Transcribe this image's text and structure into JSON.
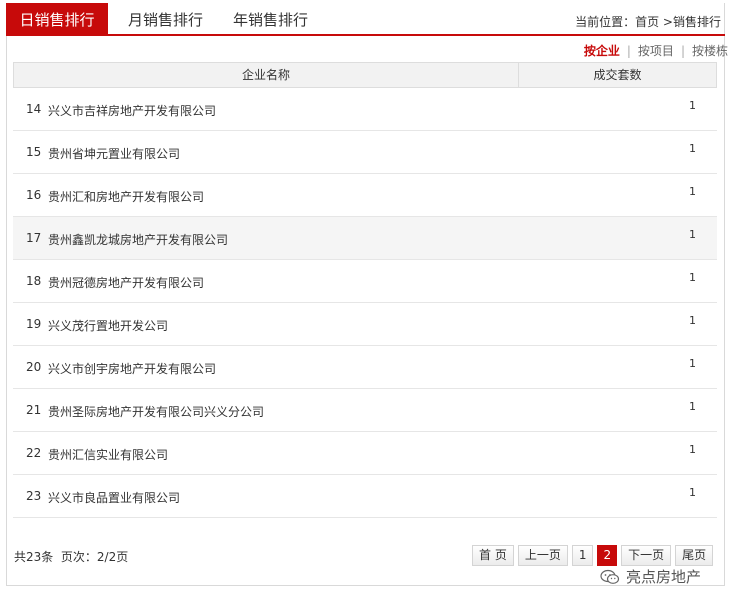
{
  "tabs": [
    {
      "label": "日销售排行",
      "active": true
    },
    {
      "label": "月销售排行",
      "active": false
    },
    {
      "label": "年销售排行",
      "active": false
    }
  ],
  "breadcrumb": {
    "prefix": "当前位置：",
    "home": "首页",
    "sep": " >",
    "current": "销售排行"
  },
  "filters": [
    {
      "label": "按企业",
      "active": true
    },
    {
      "label": "按项目",
      "active": false
    },
    {
      "label": "按楼栋",
      "active": false
    }
  ],
  "filter_sep": "|",
  "table": {
    "headers": {
      "name": "企业名称",
      "count": "成交套数"
    },
    "rows": [
      {
        "rank": "14",
        "name": "兴义市吉祥房地产开发有限公司",
        "count": "1"
      },
      {
        "rank": "15",
        "name": "贵州省坤元置业有限公司",
        "count": "1"
      },
      {
        "rank": "16",
        "name": "贵州汇和房地产开发有限公司",
        "count": "1"
      },
      {
        "rank": "17",
        "name": "贵州鑫凯龙城房地产开发有限公司",
        "count": "1"
      },
      {
        "rank": "18",
        "name": "贵州冠德房地产开发有限公司",
        "count": "1"
      },
      {
        "rank": "19",
        "name": "兴义茂行置地开发公司",
        "count": "1"
      },
      {
        "rank": "20",
        "name": "兴义市创宇房地产开发有限公司",
        "count": "1"
      },
      {
        "rank": "21",
        "name": "贵州圣际房地产开发有限公司兴义分公司",
        "count": "1"
      },
      {
        "rank": "22",
        "name": "贵州汇信实业有限公司",
        "count": "1"
      },
      {
        "rank": "23",
        "name": "兴义市良品置业有限公司",
        "count": "1"
      }
    ]
  },
  "footer": {
    "total": "共23条",
    "pages": "页次：2/2页"
  },
  "pager": {
    "first": "首 页",
    "prev": "上一页",
    "p1": "1",
    "p2": "2",
    "next": "下一页",
    "last": "尾页"
  },
  "watermark": {
    "text": "亮点房地产",
    "icon": "wechat-icon"
  },
  "colors": {
    "accent": "#c70a0a"
  }
}
